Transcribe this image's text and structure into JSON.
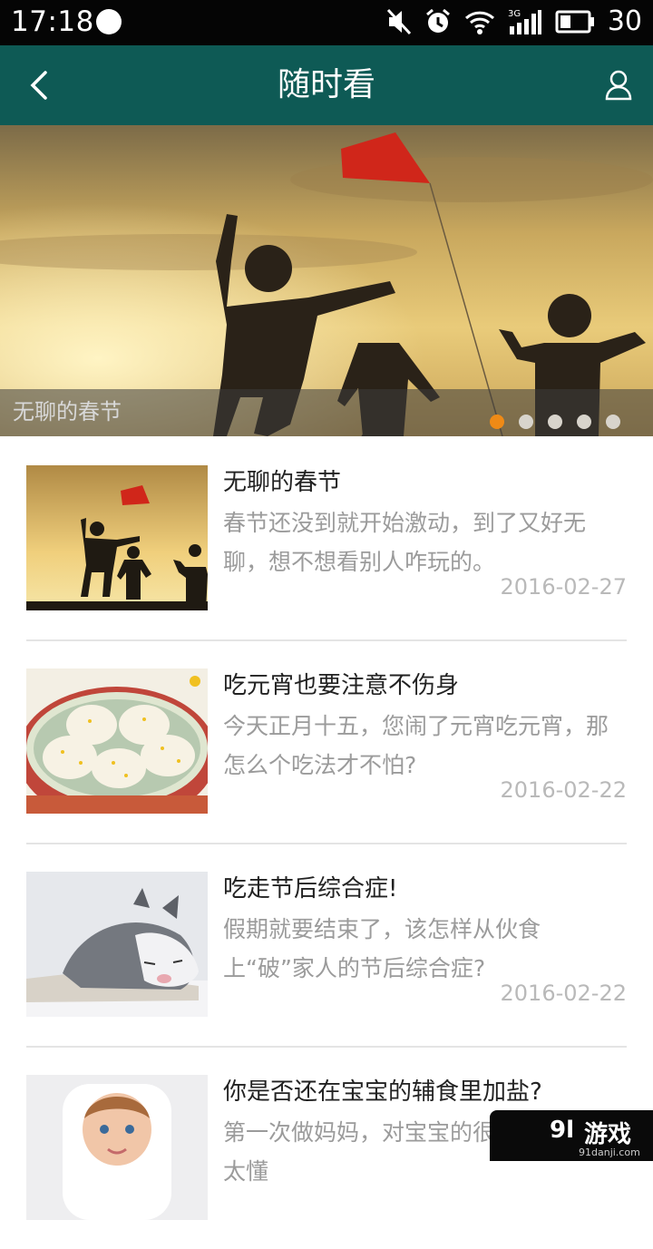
{
  "status_bar": {
    "time": "17:18",
    "battery": "30",
    "network": "3G",
    "icons": [
      "app-icon",
      "mute-icon",
      "alarm-icon",
      "wifi-icon",
      "signal-icon",
      "battery-icon"
    ]
  },
  "header": {
    "title": "随时看",
    "back_icon": "chevron-left-icon",
    "user_icon": "user-icon",
    "color": "#0e5a55"
  },
  "banner": {
    "caption": "无聊的春节",
    "slides": 5,
    "active_slide": 1,
    "active_color": "#ef8a16"
  },
  "articles": [
    {
      "title": "无聊的春节",
      "summary": "春节还没到就开始激动，到了又好无聊，想不想看别人咋玩的。",
      "date": "2016-02-27"
    },
    {
      "title": "吃元宵也要注意不伤身",
      "summary": "今天正月十五，您闹了元宵吃元宵，那怎么个吃法才不怕?",
      "date": "2016-02-22"
    },
    {
      "title": "吃走节后综合症!",
      "summary": "假期就要结束了，该怎样从伙食上“破”家人的节后综合症?",
      "date": "2016-02-22"
    },
    {
      "title": "你是否还在宝宝的辅食里加盐?",
      "summary": "第一次做妈妈，对宝宝的很多事情都不太懂",
      "date": ""
    }
  ],
  "watermark": {
    "brand": "游戏",
    "site": "91danji.com"
  }
}
